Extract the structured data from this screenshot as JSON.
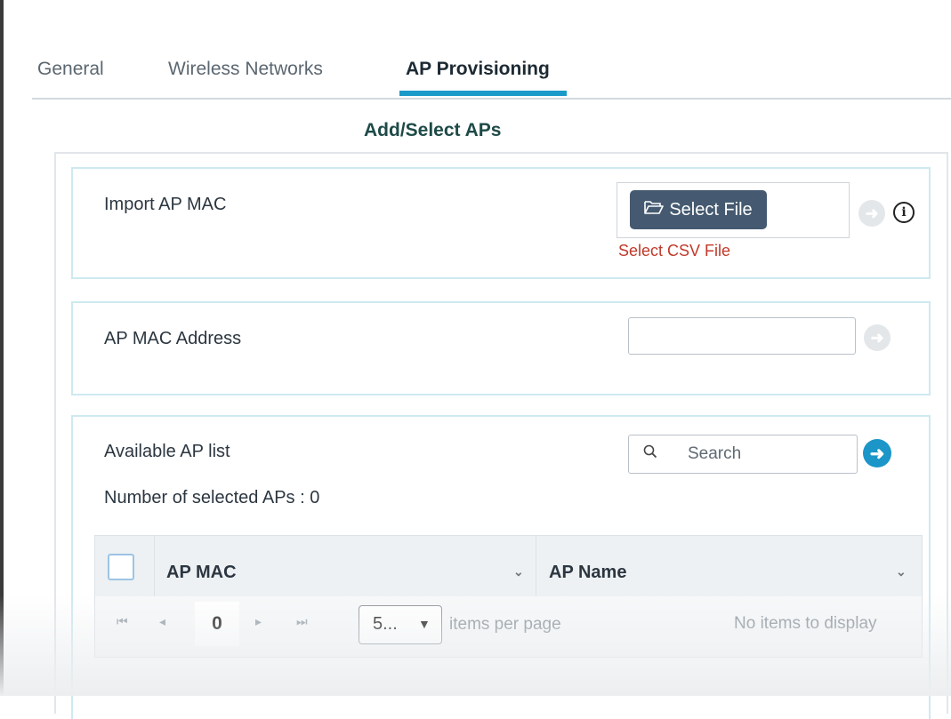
{
  "tabs": [
    {
      "label": "General"
    },
    {
      "label": "Wireless Networks"
    },
    {
      "label": "AP Provisioning"
    }
  ],
  "active_tab": "AP Provisioning",
  "section_title": "Add/Select APs",
  "import_ap_mac": {
    "label": "Import AP MAC",
    "button_label": "Select File",
    "note": "Select CSV File",
    "button_icon": "folder-open-icon"
  },
  "ap_mac_address": {
    "label": "AP MAC Address",
    "value": "",
    "placeholder": ""
  },
  "available_ap_list": {
    "label": "Available AP list",
    "search_placeholder": "Search",
    "selected_count": "Number of selected APs : 0"
  },
  "grid": {
    "columns": [
      {
        "label": "AP MAC"
      },
      {
        "label": "AP Name"
      }
    ],
    "rows": [],
    "pager": {
      "current_page": "0",
      "page_size": "5...",
      "items_per_page_label": "items per page",
      "status": "No items to display"
    }
  },
  "colors": {
    "accent": "#1b9ac9",
    "button": "#455a70",
    "error_text": "#c0392b"
  }
}
